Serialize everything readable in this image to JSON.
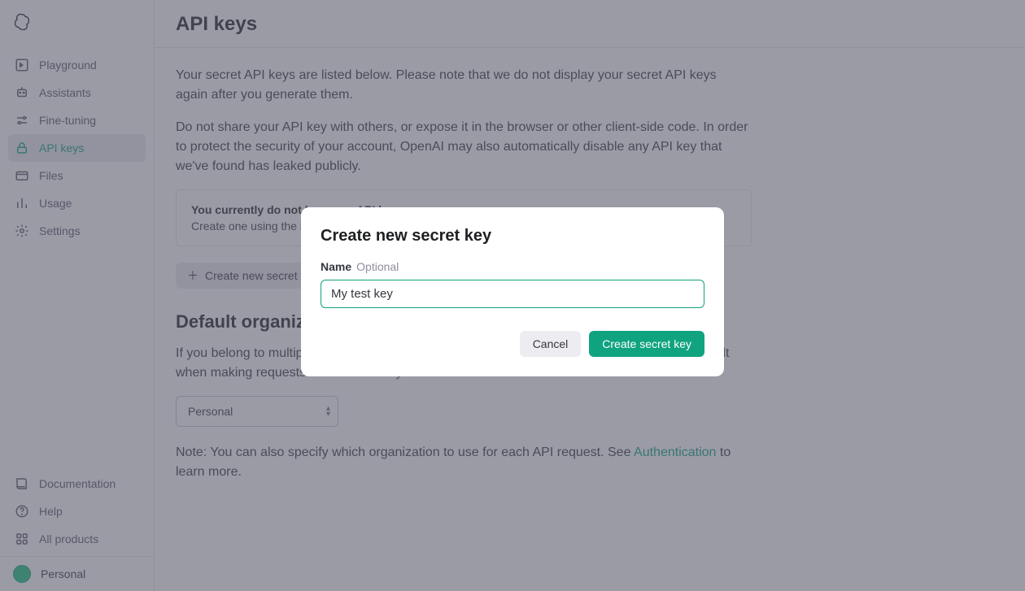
{
  "sidebar": {
    "items": [
      {
        "label": "Playground",
        "icon": "playground-icon"
      },
      {
        "label": "Assistants",
        "icon": "assistants-icon"
      },
      {
        "label": "Fine-tuning",
        "icon": "tuning-icon"
      },
      {
        "label": "API keys",
        "icon": "lock-icon"
      },
      {
        "label": "Files",
        "icon": "files-icon"
      },
      {
        "label": "Usage",
        "icon": "usage-icon"
      },
      {
        "label": "Settings",
        "icon": "gear-icon"
      }
    ],
    "bottom": [
      {
        "label": "Documentation",
        "icon": "docs-icon"
      },
      {
        "label": "Help",
        "icon": "help-icon"
      },
      {
        "label": "All products",
        "icon": "grid-icon"
      }
    ],
    "footer": {
      "label": "Personal"
    }
  },
  "page": {
    "title": "API keys",
    "intro1": "Your secret API keys are listed below. Please note that we do not display your secret API keys again after you generate them.",
    "intro2": "Do not share your API key with others, or expose it in the browser or other client-side code. In order to protect the security of your account, OpenAI may also automatically disable any API key that we've found has leaked publicly.",
    "empty": {
      "heading": "You currently do not have any API keys",
      "sub": "Create one using the button below to get started"
    },
    "create_button": "Create new secret key",
    "org_section_title": "Default organization",
    "org_desc": "If you belong to multiple organizations, this setting controls which organization is used by default when making requests with the API keys above.",
    "org_selected": "Personal",
    "note_prefix": "Note: You can also specify which organization to use for each API request. See ",
    "note_link": "Authentication",
    "note_suffix": " to learn more."
  },
  "modal": {
    "title": "Create new secret key",
    "name_label": "Name",
    "optional_label": "Optional",
    "input_value": "My test key",
    "cancel": "Cancel",
    "submit": "Create secret key"
  }
}
